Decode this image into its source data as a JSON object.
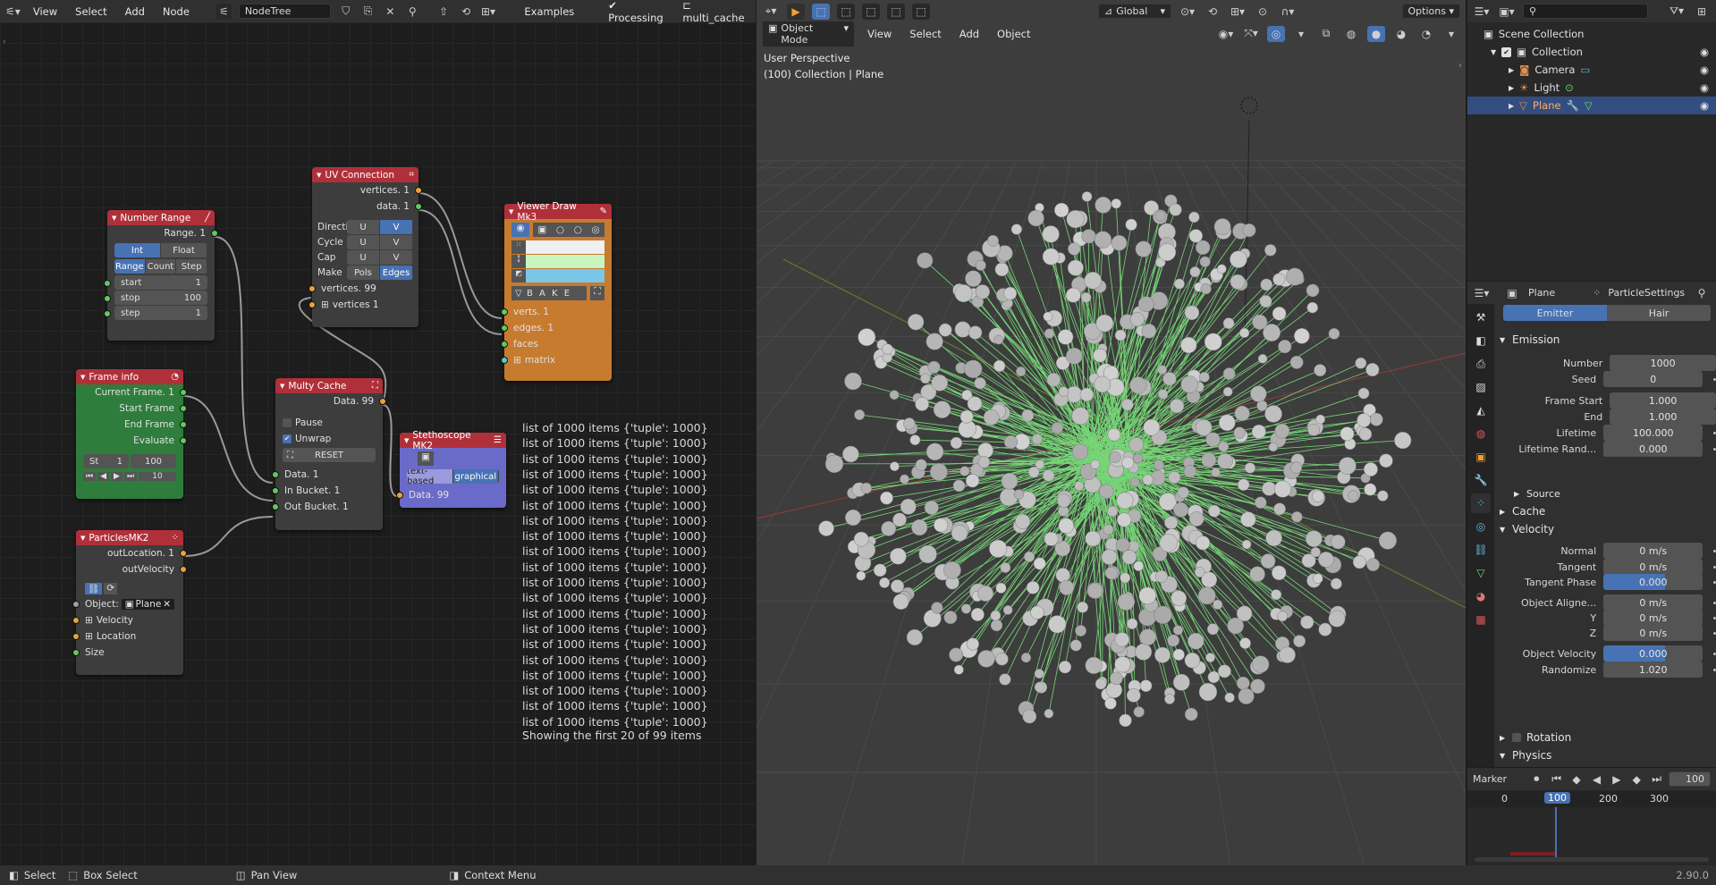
{
  "node_editor": {
    "menu": [
      "View",
      "Select",
      "Add",
      "Node"
    ],
    "tree_name": "NodeTree",
    "examples_label": "Examples",
    "processing_label": "Processing",
    "tree_tab": "multi_cache",
    "nodes": {
      "number_range": {
        "title": "Number Range",
        "out": "Range. 1",
        "modes": [
          "Int",
          "Float"
        ],
        "kinds": [
          "Range",
          "Count",
          "Step"
        ],
        "start_label": "start",
        "start": "1",
        "stop_label": "stop",
        "stop": "100",
        "step_label": "step",
        "step": "1"
      },
      "frame_info": {
        "title": "Frame info",
        "outs": [
          "Current Frame. 1",
          "Start Frame",
          "End Frame",
          "Evaluate"
        ],
        "st_label": "St",
        "st_val": "1",
        "end_val": "100",
        "fps": "10"
      },
      "particles": {
        "title": "ParticlesMK2",
        "outs": [
          "outLocation. 1",
          "outVelocity"
        ],
        "object_label": "Object:",
        "object_value": "Plane",
        "ins": [
          "Velocity",
          "Location",
          "Size"
        ]
      },
      "uv": {
        "title": "UV Connection",
        "outs": [
          "vertices. 1",
          "data. 1"
        ],
        "rows": [
          {
            "label": "Directi",
            "a": "U",
            "b": "V"
          },
          {
            "label": "Cycle",
            "a": "U",
            "b": "V"
          },
          {
            "label": "Cap",
            "a": "U",
            "b": "V"
          },
          {
            "label": "Make",
            "a": "Pols",
            "b": "Edges"
          }
        ],
        "ins": [
          "vertices. 99",
          "vertices 1"
        ]
      },
      "cache": {
        "title": "Multy Cache",
        "out": "Data. 99",
        "pause": "Pause",
        "unwrap": "Unwrap",
        "reset": "RESET",
        "ins": [
          "Data. 1",
          "In Bucket. 1",
          "Out Bucket. 1"
        ]
      },
      "viewer": {
        "title": "Viewer Draw Mk3",
        "bake": "B A K E",
        "ins": [
          "verts. 1",
          "edges. 1",
          "faces",
          "matrix"
        ]
      },
      "steth": {
        "title": "Stethoscope MK2",
        "modes": [
          "text-based",
          "graphical"
        ],
        "in": "Data. 99"
      }
    },
    "output_lines": [
      "list of 1000 items {'tuple': 1000}",
      "list of 1000 items {'tuple': 1000}",
      "list of 1000 items {'tuple': 1000}",
      "list of 1000 items {'tuple': 1000}",
      "list of 1000 items {'tuple': 1000}",
      "list of 1000 items {'tuple': 1000}",
      "list of 1000 items {'tuple': 1000}",
      "list of 1000 items {'tuple': 1000}",
      "list of 1000 items {'tuple': 1000}",
      "list of 1000 items {'tuple': 1000}",
      "list of 1000 items {'tuple': 1000}",
      "list of 1000 items {'tuple': 1000}",
      "list of 1000 items {'tuple': 1000}",
      "list of 1000 items {'tuple': 1000}",
      "list of 1000 items {'tuple': 1000}",
      "list of 1000 items {'tuple': 1000}",
      "list of 1000 items {'tuple': 1000}",
      "list of 1000 items {'tuple': 1000}",
      "list of 1000 items {'tuple': 1000}",
      "list of 1000 items {'tuple': 1000}"
    ],
    "output_footer": "Showing the first 20 of 99 items"
  },
  "viewport": {
    "mode": "Object Mode",
    "menu": [
      "View",
      "Select",
      "Add",
      "Object"
    ],
    "orientation": "Global",
    "options": "Options",
    "info_line1": "User Perspective",
    "info_line2": "(100) Collection | Plane"
  },
  "outliner": {
    "root": "Scene Collection",
    "collection": "Collection",
    "items": [
      "Camera",
      "Light",
      "Plane"
    ]
  },
  "properties": {
    "object_name": "Plane",
    "settings_name": "ParticleSettings",
    "tabs": [
      "Emitter",
      "Hair"
    ],
    "sections": {
      "emission": "Emission",
      "source": "Source",
      "cache": "Cache",
      "velocity": "Velocity",
      "rotation": "Rotation",
      "physics": "Physics"
    },
    "emission": [
      {
        "label": "Number",
        "value": "1000"
      },
      {
        "label": "Seed",
        "value": "0"
      },
      {
        "label": "Frame Start",
        "value": "1.000"
      },
      {
        "label": "End",
        "value": "1.000"
      },
      {
        "label": "Lifetime",
        "value": "100.000"
      },
      {
        "label": "Lifetime Rand...",
        "value": "0.000"
      }
    ],
    "velocity": [
      {
        "label": "Normal",
        "value": "0 m/s"
      },
      {
        "label": "Tangent",
        "value": "0 m/s"
      },
      {
        "label": "Tangent Phase",
        "value": "0.000"
      },
      {
        "label": "Object Aligne...",
        "value": "0 m/s"
      },
      {
        "label": "Y",
        "value": "0 m/s"
      },
      {
        "label": "Z",
        "value": "0 m/s"
      },
      {
        "label": "Object Velocity",
        "value": "0.000"
      },
      {
        "label": "Randomize",
        "value": "1.020"
      }
    ]
  },
  "timeline": {
    "marker": "Marker",
    "frame": "100",
    "ticks": [
      "0",
      "100",
      "200",
      "300"
    ]
  },
  "status": {
    "select": "Select",
    "box_select": "Box Select",
    "pan": "Pan View",
    "context": "Context Menu",
    "version": "2.90.0"
  },
  "colors": {
    "accent": "#4772b3",
    "node_red": "#b0303a",
    "frame_green": "#2e7d3c",
    "viewer_orange": "#c77b2e",
    "steth_purple": "#6a6ac8",
    "particle_line": "#7ee67e"
  }
}
